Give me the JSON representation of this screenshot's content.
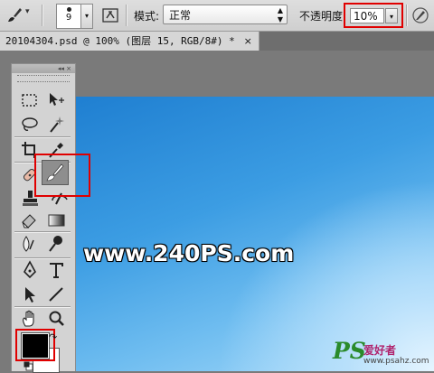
{
  "options_bar": {
    "tool_preset_icon": "brush-icon",
    "brush_size": "9",
    "brush_panel_icon": "brush-panel-icon",
    "mode_label": "模式:",
    "mode_value": "正常",
    "opacity_label": "不透明度:",
    "opacity_value": "10%",
    "airbrush_icon": "airbrush-pressure-icon"
  },
  "document_tab": {
    "title": "20104304.psd @ 100% (图层 15, RGB/8#) *",
    "close_label": "×"
  },
  "tools_panel": {
    "collapse_label": "◂◂ ×",
    "selected_tool": "brush",
    "tools": [
      "marquee-icon",
      "move-icon",
      "lasso-icon",
      "magic-wand-icon",
      "crop-icon",
      "eyedropper-icon",
      "healing-brush-icon",
      "brush-icon",
      "clone-stamp-icon",
      "history-brush-icon",
      "eraser-icon",
      "gradient-icon",
      "blur-icon",
      "dodge-icon",
      "pen-icon",
      "type-icon",
      "path-selection-icon",
      "line-icon",
      "hand-icon",
      "zoom-icon"
    ],
    "foreground_color": "#000000",
    "background_color": "#ffffff"
  },
  "canvas": {
    "watermark": "www.240PS.com"
  },
  "site_logo": {
    "mark": "PS",
    "name": "爱好者",
    "url": "www.psahz.com"
  },
  "colors": {
    "highlight": "#e00000",
    "canvas_top": "#1f7fd1",
    "canvas_light": "#e6f5ff"
  }
}
